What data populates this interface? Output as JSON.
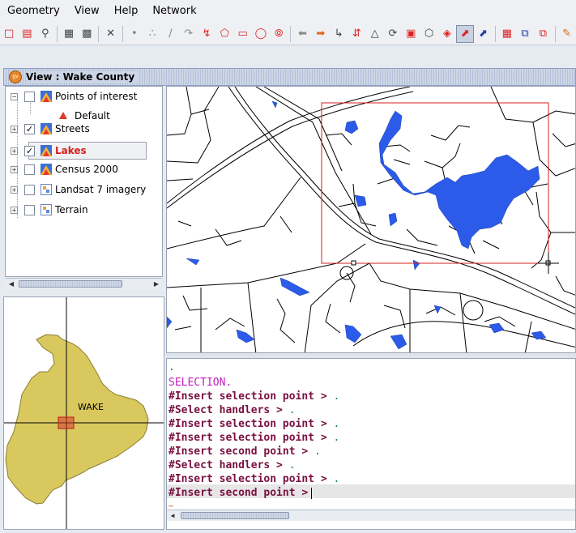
{
  "menu": [
    "Geometry",
    "View",
    "Help",
    "Network"
  ],
  "toolbar_icons": [
    "rect-select-icon",
    "zoom-icon",
    "find-icon",
    "layer-icon",
    "tools-icon",
    "point-icon",
    "multipoint-icon",
    "line-icon",
    "curve-icon",
    "polyline-icon",
    "polygon-icon",
    "rectangle-icon",
    "circle-icon",
    "ellipse-icon",
    "back-icon",
    "forward-icon",
    "redo-icon",
    "symmetry-icon",
    "scale-icon",
    "rotate-icon",
    "explode-icon",
    "join-icon",
    "shapes-icon",
    "select-icon",
    "pointer-icon",
    "table-icon",
    "copy-icon",
    "paste-icon",
    "edit-icon"
  ],
  "view": {
    "title": "View : Wake County"
  },
  "toc": {
    "layers": [
      {
        "label": "Points of interest",
        "checked": false,
        "icon": "vector"
      },
      {
        "label": "Default",
        "legend": true
      },
      {
        "label": "Streets",
        "checked": true,
        "icon": "vector"
      },
      {
        "label": "Lakes",
        "checked": true,
        "icon": "vector",
        "active": true
      },
      {
        "label": "Census 2000",
        "checked": false,
        "icon": "vector"
      },
      {
        "label": "Landsat 7 imagery",
        "checked": false,
        "icon": "raster"
      },
      {
        "label": "Terrain",
        "checked": false,
        "icon": "raster"
      }
    ]
  },
  "overview": {
    "county_label": "WAKE",
    "fill": "#d9c85e"
  },
  "map": {
    "lake_color": "#2b5be8",
    "selection_color": "#d42020"
  },
  "console": {
    "lines": [
      {
        "text": ".",
        "style": "dot"
      },
      {
        "text": "SELECTION.",
        "style": "magenta"
      },
      {
        "cmd": "#Insert selection point >",
        "tail": "."
      },
      {
        "cmd": "#Select handlers >",
        "tail": "."
      },
      {
        "cmd": "#Insert selection point >",
        "tail": "."
      },
      {
        "cmd": "#Insert selection point >",
        "tail": "."
      },
      {
        "cmd": "#Insert second point >",
        "tail": "."
      },
      {
        "cmd": "#Select handlers >",
        "tail": "."
      },
      {
        "cmd": "#Insert selection point >",
        "tail": "."
      },
      {
        "cmd": "#Insert second point >",
        "tail": ""
      },
      {
        "text": "~",
        "style": "tilde"
      }
    ]
  }
}
